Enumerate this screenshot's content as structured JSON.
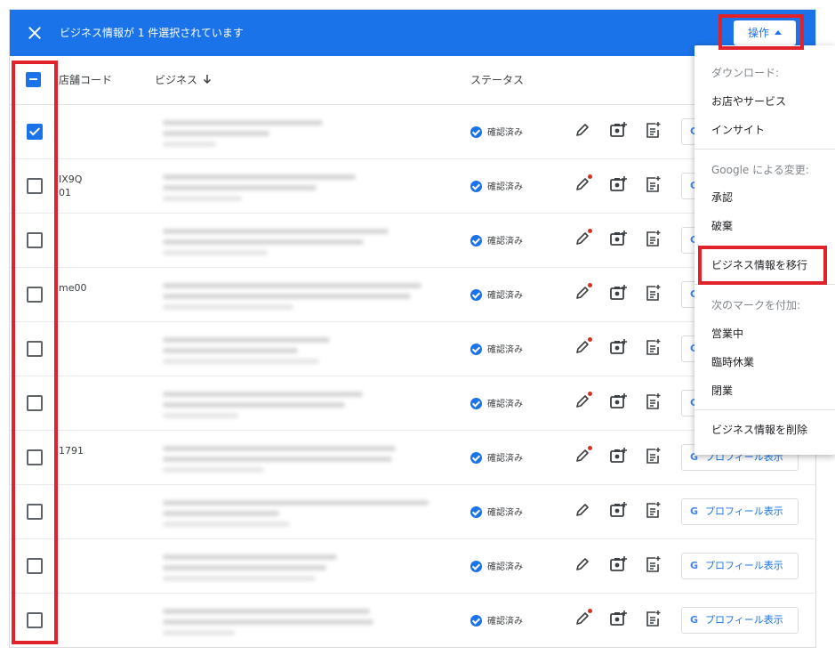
{
  "topbar": {
    "selection_text": "ビジネス情報が 1 件選択されています",
    "actions_label": "操作"
  },
  "table": {
    "headers": {
      "store_code": "店舗コード",
      "business": "ビジネス",
      "status": "ステータス"
    },
    "rows": [
      {
        "checked": true,
        "code": "",
        "status": "確認済み",
        "edit_dot": false,
        "profile_button": ""
      },
      {
        "checked": false,
        "code": "IX9Q\n01",
        "status": "確認済み",
        "edit_dot": true,
        "profile_button": ""
      },
      {
        "checked": false,
        "code": "",
        "status": "確認済み",
        "edit_dot": true,
        "profile_button": ""
      },
      {
        "checked": false,
        "code": "me00",
        "status": "確認済み",
        "edit_dot": true,
        "profile_button": ""
      },
      {
        "checked": false,
        "code": "",
        "status": "確認済み",
        "edit_dot": true,
        "profile_button": ""
      },
      {
        "checked": false,
        "code": "",
        "status": "確認済み",
        "edit_dot": true,
        "profile_button": ""
      },
      {
        "checked": false,
        "code": "1791",
        "status": "確認済み",
        "edit_dot": true,
        "profile_button": "プロフィール表示"
      },
      {
        "checked": false,
        "code": "",
        "status": "確認済み",
        "edit_dot": false,
        "profile_button": "プロフィール表示"
      },
      {
        "checked": false,
        "code": "",
        "status": "確認済み",
        "edit_dot": false,
        "profile_button": "プロフィール表示"
      },
      {
        "checked": false,
        "code": "",
        "status": "確認済み",
        "edit_dot": true,
        "profile_button": "プロフィール表示"
      }
    ]
  },
  "menu": {
    "download_header": "ダウンロード:",
    "stores_services": "お店やサービス",
    "insights": "インサイト",
    "google_changes_header": "Google による変更:",
    "approve": "承認",
    "discard": "破棄",
    "transfer": "ビジネス情報を移行",
    "mark_header": "次のマークを付加:",
    "open": "営業中",
    "temp_closed": "臨時休業",
    "closed": "閉業",
    "delete": "ビジネス情報を削除"
  },
  "colors": {
    "accent": "#1a73e8",
    "highlight": "#e0232b",
    "notification_dot": "#d93025"
  }
}
